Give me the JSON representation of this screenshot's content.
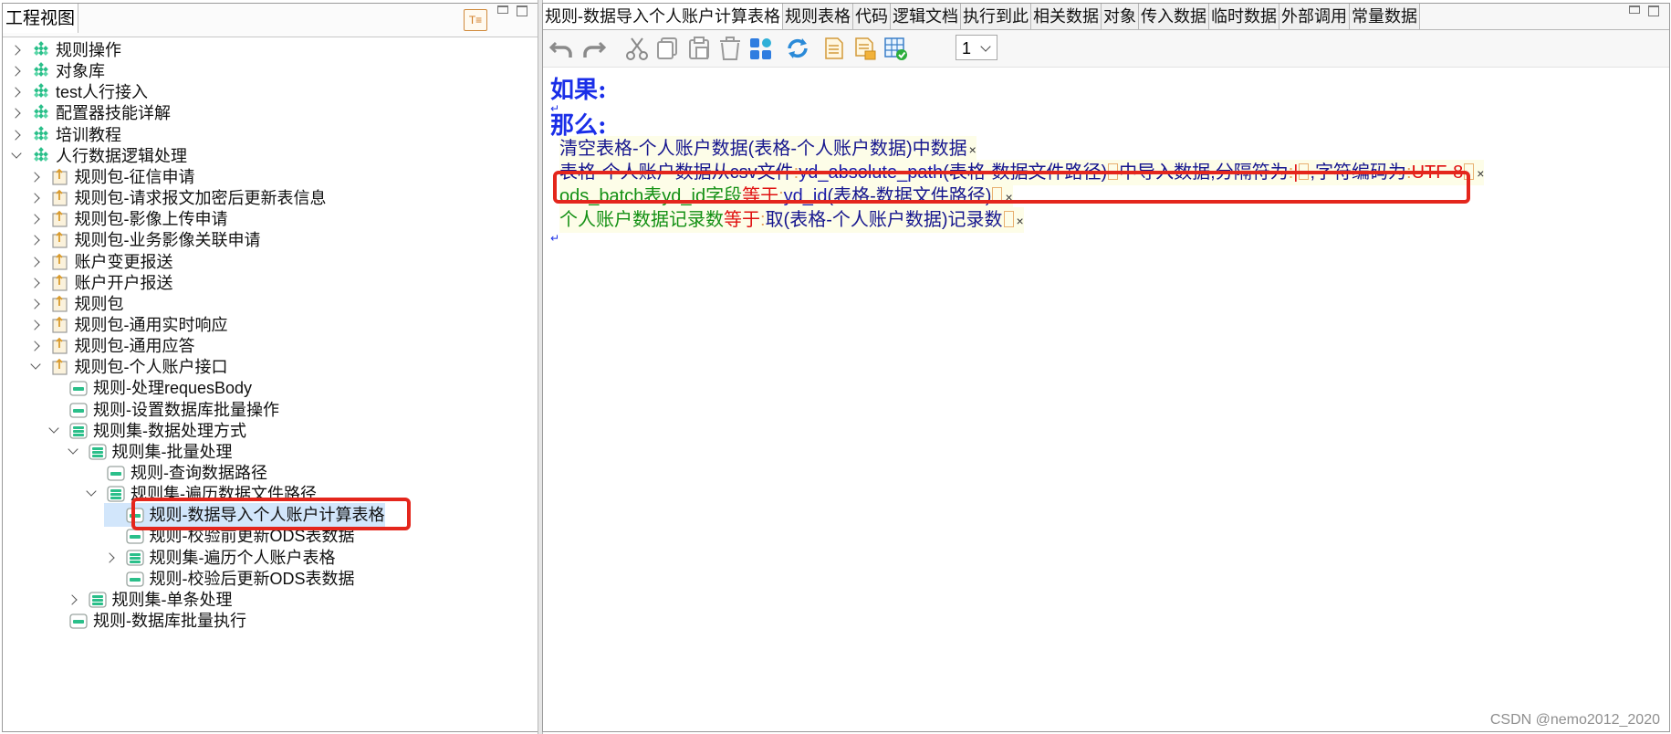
{
  "left_panel": {
    "title": "工程视图",
    "tool_icon_label": "T≡",
    "tree": [
      {
        "label": "规则操作",
        "level": 0,
        "expander": "right",
        "icon": "diamond-grid-icon"
      },
      {
        "label": "对象库",
        "level": 0,
        "expander": "right",
        "icon": "diamond-grid-icon"
      },
      {
        "label": "test人行接入",
        "level": 0,
        "expander": "right",
        "icon": "diamond-grid-icon"
      },
      {
        "label": "配置器技能详解",
        "level": 0,
        "expander": "right",
        "icon": "diamond-grid-icon"
      },
      {
        "label": "培训教程",
        "level": 0,
        "expander": "right",
        "icon": "diamond-grid-icon"
      },
      {
        "label": "人行数据逻辑处理",
        "level": 0,
        "expander": "down",
        "icon": "diamond-grid-icon"
      },
      {
        "label": "规则包-征信申请",
        "level": 1,
        "expander": "right",
        "icon": "package-icon"
      },
      {
        "label": "规则包-请求报文加密后更新表信息",
        "level": 1,
        "expander": "right",
        "icon": "package-icon"
      },
      {
        "label": "规则包-影像上传申请",
        "level": 1,
        "expander": "right",
        "icon": "package-icon"
      },
      {
        "label": "规则包-业务影像关联申请",
        "level": 1,
        "expander": "right",
        "icon": "package-icon"
      },
      {
        "label": "账户变更报送",
        "level": 1,
        "expander": "right",
        "icon": "package-icon"
      },
      {
        "label": "账户开户报送",
        "level": 1,
        "expander": "right",
        "icon": "package-icon"
      },
      {
        "label": "规则包",
        "level": 1,
        "expander": "right",
        "icon": "package-icon"
      },
      {
        "label": "规则包-通用实时响应",
        "level": 1,
        "expander": "right",
        "icon": "package-icon"
      },
      {
        "label": "规则包-通用应答",
        "level": 1,
        "expander": "right",
        "icon": "package-icon"
      },
      {
        "label": "规则包-个人账户接口",
        "level": 1,
        "expander": "down",
        "icon": "package-icon"
      },
      {
        "label": "规则-处理requesBody",
        "level": 2,
        "expander": "none",
        "icon": "rule-icon"
      },
      {
        "label": "规则-设置数据库批量操作",
        "level": 2,
        "expander": "none",
        "icon": "rule-icon"
      },
      {
        "label": "规则集-数据处理方式",
        "level": 2,
        "expander": "down",
        "icon": "ruleset-icon"
      },
      {
        "label": "规则集-批量处理",
        "level": 3,
        "expander": "down",
        "icon": "ruleset-icon"
      },
      {
        "label": "规则-查询数据路径",
        "level": 4,
        "expander": "none",
        "icon": "rule-icon"
      },
      {
        "label": "规则集-遍历数据文件路径",
        "level": 4,
        "expander": "down",
        "icon": "ruleset-icon"
      },
      {
        "label": "规则-数据导入个人账户计算表格",
        "level": 5,
        "expander": "none",
        "icon": "rule-icon",
        "selected": true
      },
      {
        "label": "规则-校验前更新ODS表数据",
        "level": 5,
        "expander": "none",
        "icon": "rule-icon"
      },
      {
        "label": "规则集-遍历个人账户表格",
        "level": 5,
        "expander": "right",
        "icon": "ruleset-icon"
      },
      {
        "label": "规则-校验后更新ODS表数据",
        "level": 5,
        "expander": "none",
        "icon": "rule-icon"
      },
      {
        "label": "规则集-单条处理",
        "level": 3,
        "expander": "right",
        "icon": "ruleset-icon"
      },
      {
        "label": "规则-数据库批量执行",
        "level": 2,
        "expander": "none",
        "icon": "rule-icon"
      }
    ]
  },
  "right_panel": {
    "tabs": [
      {
        "label": "规则-数据导入个人账户计算表格",
        "active": true
      },
      {
        "label": "规则表格",
        "active": false
      },
      {
        "label": "代码",
        "active": false
      },
      {
        "label": "逻辑文档",
        "active": false
      },
      {
        "label": "执行到此",
        "active": false
      },
      {
        "label": "相关数据",
        "active": false
      },
      {
        "label": "对象",
        "active": false
      },
      {
        "label": "传入数据",
        "active": false
      },
      {
        "label": "临时数据",
        "active": false
      },
      {
        "label": "外部调用",
        "active": false
      },
      {
        "label": "常量数据",
        "active": false
      }
    ],
    "toolbar": {
      "buttons": [
        "undo-icon",
        "redo-icon",
        "cut-icon",
        "copy-icon",
        "paste-icon",
        "delete-icon",
        "grid-blocks-icon",
        "refresh-icon",
        "doc-icon",
        "doc-export-icon",
        "table-check-icon"
      ],
      "zoom_value": "1"
    },
    "editor": {
      "if_label": "如果:",
      "then_label": "那么:",
      "statements": [
        {
          "parts": [
            {
              "t": "清空表格-个人账户数据(表格-个人账户数据)中数据",
              "c": "c-navy"
            },
            {
              "t": "×",
              "c": "xmark"
            }
          ]
        },
        {
          "parts": [
            {
              "t": "表格-个人账户数据",
              "c": "c-navy"
            },
            {
              "t": "从csv文件",
              "c": "c-navy"
            },
            {
              "t": ":",
              "c": "colon"
            },
            {
              "t": "yd_absolute_path",
              "c": "c-blue"
            },
            {
              "t": "(表格-数据文件路径)",
              "c": "c-navy"
            },
            {
              "t": "[]",
              "c": "ph"
            },
            {
              "t": "中导入数据,分隔符为",
              "c": "c-navy"
            },
            {
              "t": ":",
              "c": "colon"
            },
            {
              "t": "|",
              "c": "c-red"
            },
            {
              "t": "[]",
              "c": "ph"
            },
            {
              "t": ",字符编码为",
              "c": "c-navy"
            },
            {
              "t": ":",
              "c": "colon"
            },
            {
              "t": "UTF-8",
              "c": "c-red"
            },
            {
              "t": "[]",
              "c": "ph"
            },
            {
              "t": "×",
              "c": "xmark"
            }
          ]
        },
        {
          "parts": [
            {
              "t": "ods_batch",
              "c": "c-green"
            },
            {
              "t": "表",
              "c": "c-green"
            },
            {
              "t": "yd_id",
              "c": "c-green"
            },
            {
              "t": "字段",
              "c": "c-green"
            },
            {
              "t": "等于",
              "c": "c-red"
            },
            {
              "t": ":",
              "c": "colon"
            },
            {
              "t": "yd_id",
              "c": "c-blue"
            },
            {
              "t": "(表格-数据文件路径)",
              "c": "c-navy"
            },
            {
              "t": "[]",
              "c": "ph"
            },
            {
              "t": "×",
              "c": "xmark"
            }
          ]
        },
        {
          "parts": [
            {
              "t": "个人账户数据记录数",
              "c": "c-green"
            },
            {
              "t": "等于",
              "c": "c-red"
            },
            {
              "t": ":",
              "c": "colon"
            },
            {
              "t": "取(表格-个人账户数据)记录数",
              "c": "c-navy"
            },
            {
              "t": "[]",
              "c": "ph"
            },
            {
              "t": "×",
              "c": "xmark"
            }
          ]
        }
      ]
    }
  },
  "watermark": "CSDN @nemo2012_2020"
}
